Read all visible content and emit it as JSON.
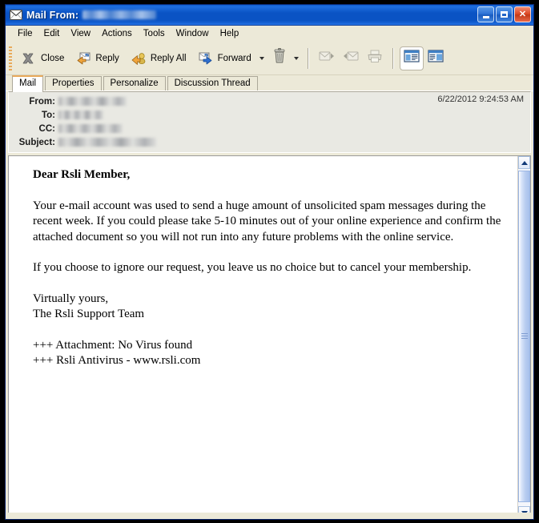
{
  "window": {
    "title_prefix": "Mail From:",
    "title_sender_redacted": "[redacted]",
    "icon": "envelope-icon",
    "controls": {
      "minimize": "Minimize",
      "maximize": "Maximize",
      "close": "Close"
    }
  },
  "menubar": {
    "items": [
      {
        "label": "File"
      },
      {
        "label": "Edit"
      },
      {
        "label": "View"
      },
      {
        "label": "Actions"
      },
      {
        "label": "Tools"
      },
      {
        "label": "Window"
      },
      {
        "label": "Help"
      }
    ]
  },
  "toolbar": {
    "close_label": "Close",
    "reply_label": "Reply",
    "reply_all_label": "Reply All",
    "forward_label": "Forward",
    "icons": {
      "close": "x-icon",
      "reply": "reply-arrow-icon",
      "reply_all": "reply-all-arrow-icon",
      "forward": "forward-arrow-icon",
      "forward_dropdown": "chevron-down-icon",
      "delete": "trash-can-icon",
      "delete_dropdown": "chevron-down-icon",
      "next_mail": "next-mail-icon",
      "previous_mail": "previous-mail-icon",
      "print": "printer-icon",
      "view_layout_1": "reading-pane-right-icon",
      "view_layout_2": "reading-pane-bottom-icon"
    }
  },
  "tabs": [
    {
      "label": "Mail",
      "active": true
    },
    {
      "label": "Properties",
      "active": false
    },
    {
      "label": "Personalize",
      "active": false
    },
    {
      "label": "Discussion Thread",
      "active": false
    }
  ],
  "header": {
    "from_label": "From:",
    "to_label": "To:",
    "cc_label": "CC:",
    "subject_label": "Subject:",
    "from_value_redacted": "[redacted]",
    "to_value_redacted": "[redacted]",
    "cc_value_redacted": "[redacted]",
    "subject_value_redacted": "[redacted]",
    "datestamp": "6/22/2012 9:24:53 AM"
  },
  "body": {
    "salutation": "Dear Rsli Member,",
    "paragraph_1": "Your e-mail account was used to send a huge amount of unsolicited spam messages during the recent week. If you could please take 5-10 minutes out of your online experience and confirm the attached document so you will not run into any future problems with the online service.",
    "paragraph_2": "If you choose to ignore our request, you leave us no choice but to cancel your membership.",
    "signoff_line_1": "Virtually yours,",
    "signoff_line_2": "The Rsli Support Team",
    "footer_line_1": "+++ Attachment: No Virus found",
    "footer_line_2": "+++ Rsli Antivirus - www.rsli.com"
  },
  "scrollbar": {
    "up_arrow": "scroll-up-icon",
    "down_arrow": "scroll-down-icon"
  },
  "colors": {
    "titlebar_blue": "#0a53c4",
    "chrome": "#ece9d8",
    "active_tab_accent": "#e8a95a",
    "close_button_red": "#dd4a26",
    "body_background": "#ffffff"
  }
}
